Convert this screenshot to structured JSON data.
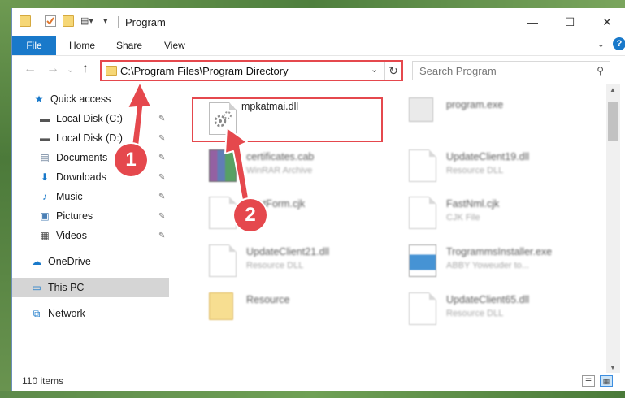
{
  "window": {
    "title": "Program",
    "controls": {
      "minimize": "—",
      "maximize": "☐",
      "close": "✕"
    }
  },
  "ribbon": {
    "tabs": [
      "File",
      "Home",
      "Share",
      "View"
    ],
    "expand": "⌄",
    "help": "?"
  },
  "nav": {
    "back": "←",
    "forward": "→",
    "recent": "⌄",
    "up": "↑",
    "address": "C:\\Program Files\\Program Directory",
    "address_dropdown": "⌄",
    "refresh": "↻",
    "search_placeholder": "Search Program",
    "search_icon": "⚲"
  },
  "sidebar": {
    "items": [
      {
        "label": "Quick access",
        "icon": "star-icon",
        "glyph": "★",
        "pinned": false
      },
      {
        "label": "Local Disk (C:)",
        "icon": "drive-icon",
        "glyph": "▬",
        "pinned": true
      },
      {
        "label": "Local Disk (D:)",
        "icon": "drive-icon",
        "glyph": "▬",
        "pinned": true
      },
      {
        "label": "Documents",
        "icon": "documents-icon",
        "glyph": "▤",
        "pinned": true
      },
      {
        "label": "Downloads",
        "icon": "download-icon",
        "glyph": "⬇",
        "pinned": true
      },
      {
        "label": "Music",
        "icon": "music-icon",
        "glyph": "♪",
        "pinned": true
      },
      {
        "label": "Pictures",
        "icon": "pictures-icon",
        "glyph": "▣",
        "pinned": true
      },
      {
        "label": "Videos",
        "icon": "videos-icon",
        "glyph": "▦",
        "pinned": true
      },
      {
        "label": "OneDrive",
        "icon": "cloud-icon",
        "glyph": "☁",
        "pinned": false
      },
      {
        "label": "This PC",
        "icon": "computer-icon",
        "glyph": "▭",
        "pinned": false,
        "selected": true
      },
      {
        "label": "Network",
        "icon": "network-icon",
        "glyph": "⧉",
        "pinned": false
      }
    ],
    "pin_glyph": "📌"
  },
  "files": {
    "left": [
      {
        "name": "mpkatmai.dll",
        "type": "",
        "icon": "dll-gear-icon"
      },
      {
        "name": "certificates.cab",
        "type": "WinRAR Archive",
        "icon": "winrar-icon"
      },
      {
        "name": "FastForm.cjk",
        "type": "",
        "icon": "file-icon"
      },
      {
        "name": "UpdateClient21.dll",
        "type": "Resource DLL",
        "icon": "dll-gear-icon"
      },
      {
        "name": "Resource",
        "type": "",
        "icon": "folder-icon"
      }
    ],
    "right": [
      {
        "name": "program.exe",
        "type": "",
        "icon": "exe-icon"
      },
      {
        "name": "UpdateClient19.dll",
        "type": "Resource DLL",
        "icon": "file-icon"
      },
      {
        "name": "FastNml.cjk",
        "type": "CJK File",
        "icon": "file-icon"
      },
      {
        "name": "TrogrammsInstaller.exe",
        "type": "ABBY Yoweuder to...",
        "icon": "installer-icon"
      },
      {
        "name": "UpdateClient65.dll",
        "type": "Resource DLL",
        "icon": "file-icon"
      }
    ]
  },
  "status": {
    "item_count": "110 items",
    "details_view": "☰",
    "icons_view": "▦"
  },
  "callouts": [
    {
      "number": "1"
    },
    {
      "number": "2"
    }
  ],
  "colors": {
    "accent": "#1979ca",
    "highlight": "#e5484d",
    "selected": "#d5d5d5"
  }
}
